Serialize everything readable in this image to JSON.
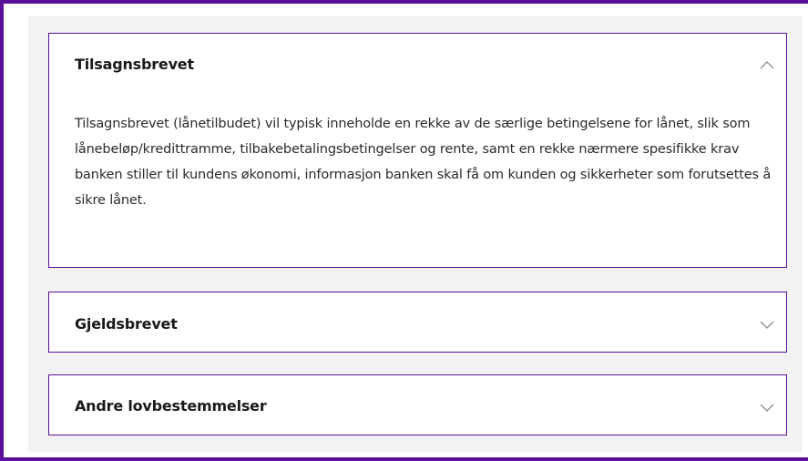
{
  "accordion": {
    "items": [
      {
        "title": "Tilsagnsbrevet",
        "expanded": true,
        "body": "Tilsagnsbrevet (lånetilbudet) vil typisk inneholde en rekke av de særlige betingelsene for lånet, slik som lånebeløp/kredittramme, tilbakebetalingsbetingelser og rente, samt en rekke nærmere spesifikke krav banken stiller til kundens økonomi, informasjon banken skal få om kunden og sikkerheter som forutsettes å sikre lånet."
      },
      {
        "title": "Gjeldsbrevet",
        "expanded": false
      },
      {
        "title": "Andre lovbestemmelser",
        "expanded": false
      }
    ]
  },
  "colors": {
    "accent": "#5a0f9a",
    "panel_bg": "#f2f2f2",
    "text": "#1a1a1a"
  }
}
